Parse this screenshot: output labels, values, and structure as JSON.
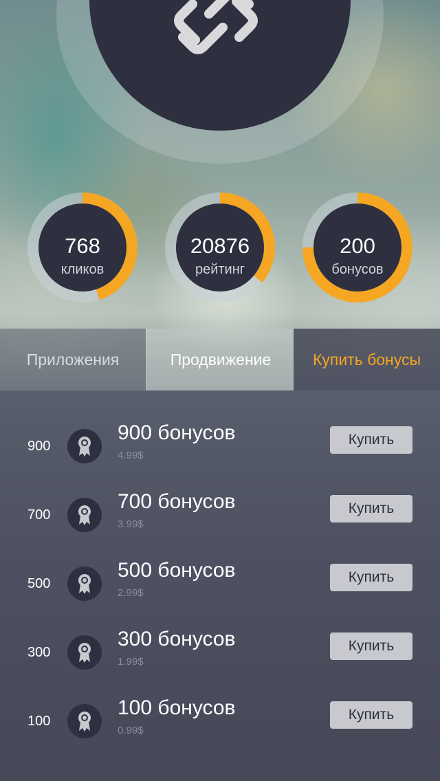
{
  "colors": {
    "accent": "#f5a623",
    "dark": "#2e2f3f",
    "ring_track": "#8f9aa0",
    "button_bg": "#c8c9ce"
  },
  "header": {
    "logo_icon": "chain-link-icon"
  },
  "stats": [
    {
      "value": "768",
      "label": "кликов",
      "progress": 0.45
    },
    {
      "value": "20876",
      "label": "рейтинг",
      "progress": 0.36
    },
    {
      "value": "200",
      "label": "бонусов",
      "progress": 0.75
    }
  ],
  "tabs": [
    {
      "label": "Приложения",
      "state": "inactive"
    },
    {
      "label": "Продвижение",
      "state": "inactive"
    },
    {
      "label": "Купить бонусы",
      "state": "active"
    }
  ],
  "bonus_list": {
    "item_icon": "award-ribbon-icon",
    "items": [
      {
        "qty": "900",
        "title": "900 бонусов",
        "price": "4.99$",
        "button": "Купить"
      },
      {
        "qty": "700",
        "title": "700 бонусов",
        "price": "3.99$",
        "button": "Купить"
      },
      {
        "qty": "500",
        "title": "500 бонусов",
        "price": "2.99$",
        "button": "Купить"
      },
      {
        "qty": "300",
        "title": "300 бонусов",
        "price": "1.99$",
        "button": "Купить"
      },
      {
        "qty": "100",
        "title": "100 бонусов",
        "price": "0.99$",
        "button": "Купить"
      }
    ]
  }
}
